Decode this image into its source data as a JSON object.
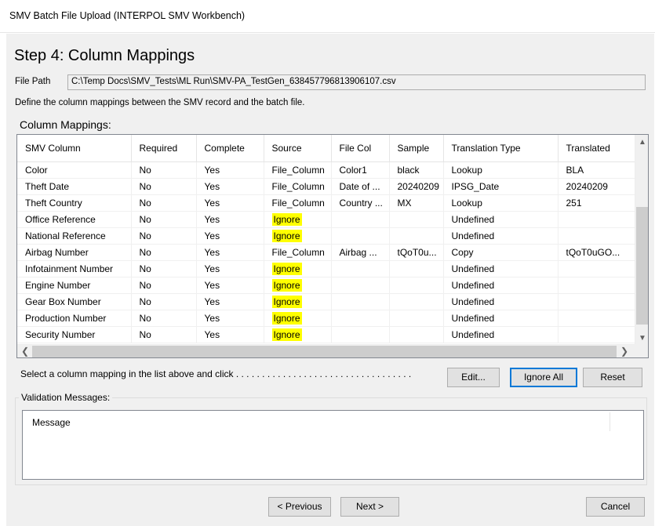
{
  "window": {
    "title": "SMV Batch File Upload (INTERPOL SMV Workbench)"
  },
  "step": {
    "title": "Step 4: Column Mappings"
  },
  "file_path": {
    "label": "File Path",
    "value": "C:\\Temp Docs\\SMV_Tests\\ML Run\\SMV-PA_TestGen_638457796813906107.csv"
  },
  "instructions": "Define the column mappings between the SMV record and the batch file.",
  "mappings": {
    "group_label": "Column Mappings:",
    "columns": [
      "SMV Column",
      "Required",
      "Complete",
      "Source",
      "File Col",
      "Sample",
      "Translation Type",
      "Translated"
    ],
    "rows": [
      [
        "Color",
        "No",
        "Yes",
        "File_Column",
        "Color1",
        "black",
        "Lookup",
        "BLA"
      ],
      [
        "Theft Date",
        "No",
        "Yes",
        "File_Column",
        "Date of ...",
        "20240209",
        "IPSG_Date",
        "20240209"
      ],
      [
        "Theft Country",
        "No",
        "Yes",
        "File_Column",
        "Country ...",
        "MX",
        "Lookup",
        "251"
      ],
      [
        "Office Reference",
        "No",
        "Yes",
        "Ignore",
        "",
        "",
        "Undefined",
        ""
      ],
      [
        "National Reference",
        "No",
        "Yes",
        "Ignore",
        "",
        "",
        "Undefined",
        ""
      ],
      [
        "Airbag Number",
        "No",
        "Yes",
        "File_Column",
        "Airbag ...",
        "tQoT0u...",
        "Copy",
        "tQoT0uGO..."
      ],
      [
        "Infotainment Number",
        "No",
        "Yes",
        "Ignore",
        "",
        "",
        "Undefined",
        ""
      ],
      [
        "Engine Number",
        "No",
        "Yes",
        "Ignore",
        "",
        "",
        "Undefined",
        ""
      ],
      [
        "Gear Box Number",
        "No",
        "Yes",
        "Ignore",
        "",
        "",
        "Undefined",
        ""
      ],
      [
        "Production Number",
        "No",
        "Yes",
        "Ignore",
        "",
        "",
        "Undefined",
        ""
      ],
      [
        "Security Number",
        "No",
        "Yes",
        "Ignore",
        "",
        "",
        "Undefined",
        ""
      ]
    ],
    "highlight_color": "#ffff00"
  },
  "actions": {
    "hint": "Select a column mapping in the list above and click . . . . . . . . . . . . . . . . . . . . . . . . . . . . . . . . . .",
    "edit_label": "Edit...",
    "ignore_all_label": "Ignore All",
    "reset_label": "Reset"
  },
  "validation": {
    "group_label": "Validation Messages:",
    "column_header": "Message"
  },
  "footer": {
    "previous_label": "< Previous",
    "next_label": "Next >",
    "cancel_label": "Cancel"
  }
}
